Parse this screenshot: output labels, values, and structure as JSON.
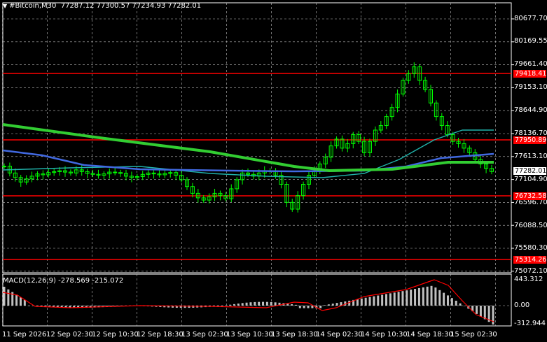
{
  "header": {
    "symbol": "#Bitcoin,M30",
    "ohlc": "77287.12 77300.57 77234.93 77282.01"
  },
  "price_axis": {
    "ticks": [
      "80677.70",
      "80169.55",
      "79661.40",
      "79153.10",
      "78644.90",
      "78136.70",
      "77613.10",
      "77104.90",
      "76596.70",
      "76088.50",
      "75580.30",
      "75072.10"
    ],
    "current_price": "77282.01"
  },
  "levels": [
    {
      "label": "79418.41",
      "price": 79418.41
    },
    {
      "label": "77950.89",
      "price": 77950.89
    },
    {
      "label": "76732.58",
      "price": 76732.58
    },
    {
      "label": "75314.26",
      "price": 75314.26
    }
  ],
  "macd": {
    "label": "MACD(12,26,9)",
    "values": "-278.569 -215.072",
    "axis_ticks": [
      "443.312",
      "0.00",
      "-312.944"
    ]
  },
  "time_axis": {
    "ticks": [
      "11 Sep 2026",
      "12 Sep 02:30",
      "12 Sep 10:30",
      "12 Sep 18:30",
      "13 Sep 02:30",
      "13 Sep 10:30",
      "13 Sep 18:30",
      "14 Sep 02:30",
      "14 Sep 10:30",
      "14 Sep 18:30",
      "15 Sep 02:30"
    ]
  },
  "colors": {
    "background": "#000000",
    "grid": "#c0c0c0",
    "candles": "#00ff00",
    "level_line": "#ff0000",
    "ma_slow": "#32cd32",
    "ma_mid": "#4169e1",
    "ma_fast": "#20b2aa",
    "macd_hist": "#c0c0c0",
    "macd_signal": "#ff0000"
  },
  "chart_data": {
    "type": "candlestick",
    "symbol": "#Bitcoin",
    "timeframe": "M30",
    "ylim": [
      75072.1,
      80677.7
    ],
    "close_series": [
      77400,
      77250,
      77150,
      77050,
      77120,
      77180,
      77230,
      77210,
      77260,
      77280,
      77300,
      77270,
      77250,
      77320,
      77280,
      77240,
      77220,
      77200,
      77230,
      77270,
      77260,
      77240,
      77180,
      77150,
      77170,
      77220,
      77250,
      77230,
      77210,
      77240,
      77260,
      77200,
      77100,
      76950,
      76800,
      76700,
      76650,
      76720,
      76800,
      76750,
      76680,
      76900,
      77100,
      77250,
      77220,
      77180,
      77250,
      77300,
      77280,
      77200,
      77000,
      76600,
      76450,
      76750,
      77000,
      77200,
      77300,
      77450,
      77600,
      77850,
      78000,
      77800,
      77900,
      78100,
      77950,
      77700,
      77950,
      78200,
      78300,
      78500,
      78700,
      79000,
      79300,
      79450,
      79600,
      79300,
      79100,
      78800,
      78500,
      78300,
      78100,
      77950,
      77900,
      77800,
      77700,
      77550,
      77450,
      77350,
      77282
    ]
  }
}
